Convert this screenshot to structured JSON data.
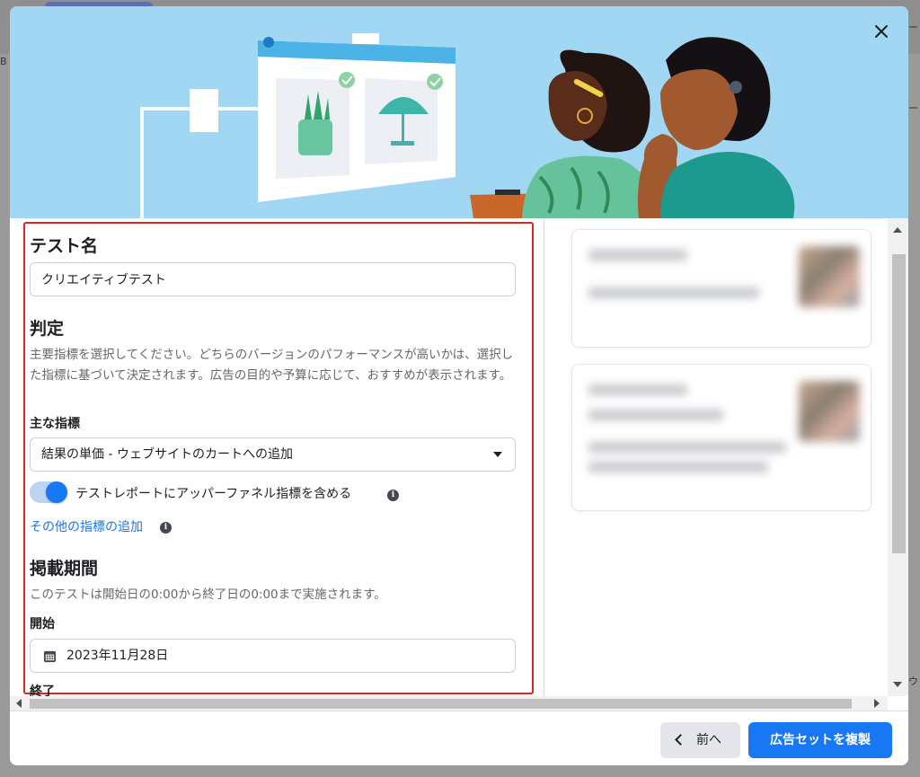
{
  "background": {
    "left_glimpse": "B",
    "right_glimpse_1": "ー",
    "right_glimpse_2": "ー",
    "right_glimpse_3": "ウ"
  },
  "modal": {
    "close_icon": "close-icon",
    "form": {
      "test_name": {
        "heading": "テスト名",
        "value": "クリエイティブテスト"
      },
      "judgment": {
        "heading": "判定",
        "description": "主要指標を選択してください。どちらのバージョンのパフォーマンスが高いかは、選択した指標に基づいて決定されます。広告の目的や予算に応じて、おすすめが表示されます。",
        "metric_label": "主な指標",
        "metric_value": "結果の単価 - ウェブサイトのカートへの追加",
        "toggle_label": "テストレポートにアッパーファネル指標を含める",
        "toggle_on": true,
        "add_metrics_link": "その他の指標の追加"
      },
      "schedule": {
        "heading": "掲載期間",
        "description": "このテストは開始日の0:00から終了日の0:00まで実施されます。",
        "start_label": "開始",
        "start_value": "2023年11月28日",
        "end_label": "終了"
      }
    },
    "footer": {
      "back_label": "前へ",
      "primary_label": "広告セットを複製"
    }
  },
  "colors": {
    "hero_bg": "#a2d7f3",
    "accent": "#1877f2",
    "highlight_border": "#e02424"
  }
}
